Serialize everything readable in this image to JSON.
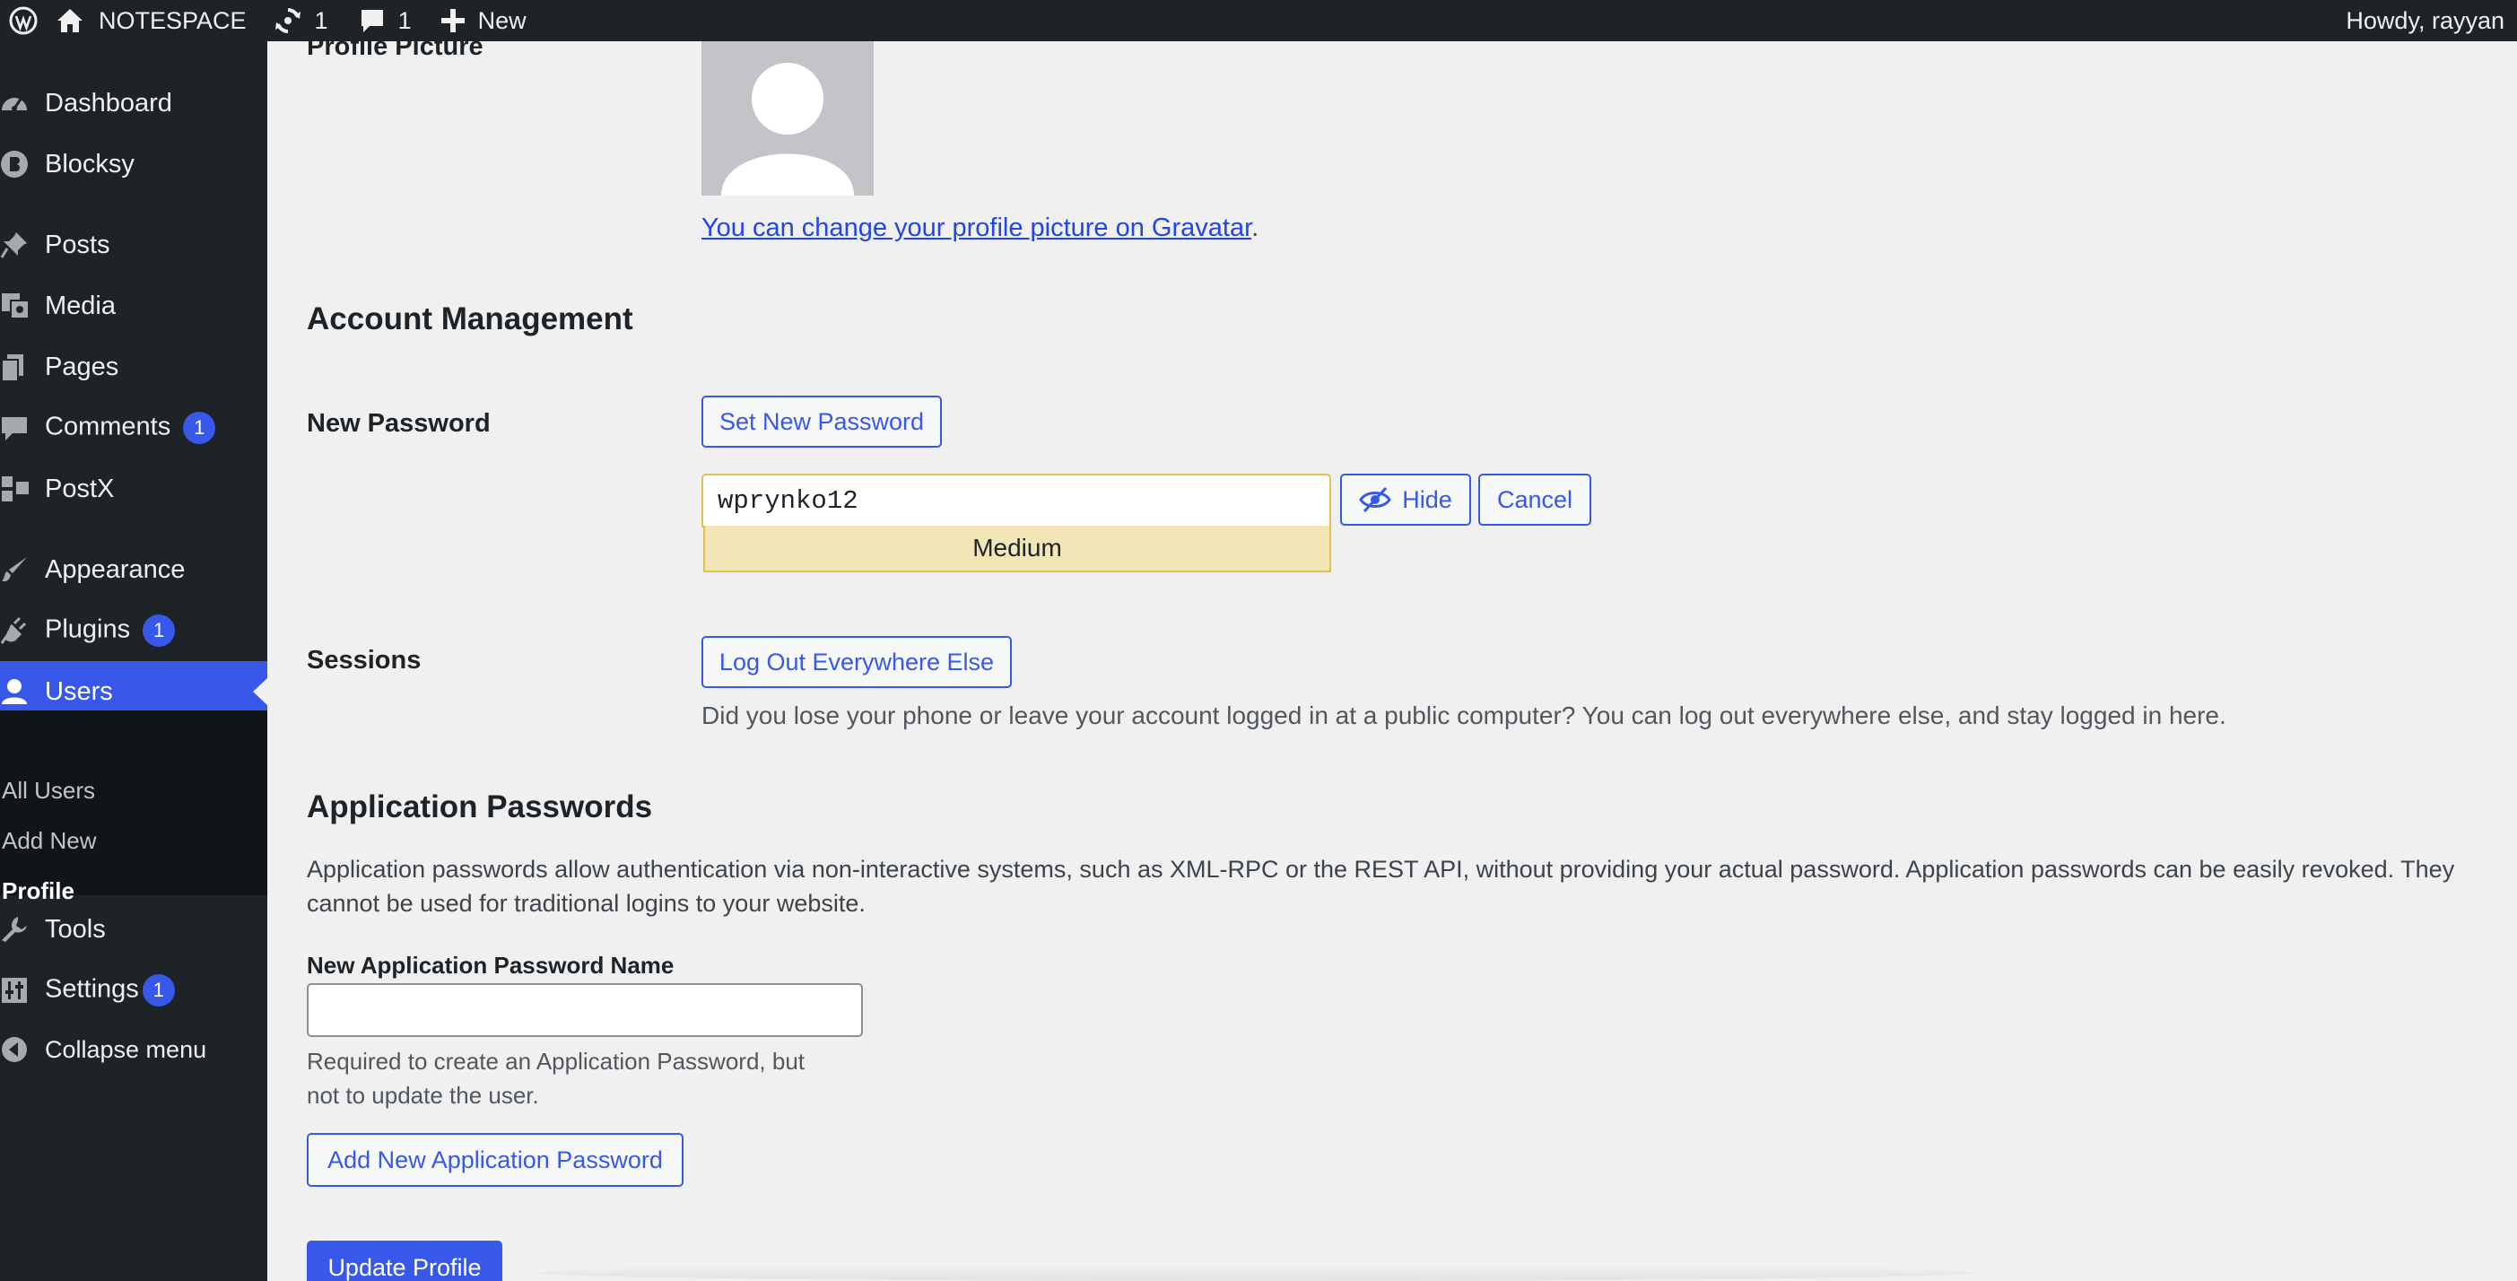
{
  "adminbar": {
    "site_name": "NOTESPACE",
    "updates_count": "1",
    "comments_count": "1",
    "new_label": "New",
    "howdy": "Howdy, rayyan"
  },
  "sidebar": {
    "items": [
      {
        "label": "Dashboard",
        "icon": "dashboard-icon"
      },
      {
        "label": "Blocksy",
        "icon": "blocksy-icon"
      },
      {
        "label": "Posts",
        "icon": "pin-icon"
      },
      {
        "label": "Media",
        "icon": "media-icon"
      },
      {
        "label": "Pages",
        "icon": "pages-icon"
      },
      {
        "label": "Comments",
        "icon": "comment-icon",
        "badge": "1"
      },
      {
        "label": "PostX",
        "icon": "postx-icon"
      },
      {
        "label": "Appearance",
        "icon": "brush-icon"
      },
      {
        "label": "Plugins",
        "icon": "plug-icon",
        "badge": "1"
      },
      {
        "label": "Users",
        "icon": "user-icon",
        "current": true
      },
      {
        "label": "Tools",
        "icon": "wrench-icon"
      },
      {
        "label": "Settings",
        "icon": "settings-icon",
        "badge": "1"
      },
      {
        "label": "Collapse menu",
        "icon": "collapse-icon"
      }
    ],
    "submenu": [
      "All Users",
      "Add New",
      "Profile"
    ],
    "active_submenu": "Profile"
  },
  "profile_picture": {
    "label": "Profile Picture",
    "link_text": "You can change your profile picture on Gravatar",
    "link_suffix": "."
  },
  "account_management": {
    "heading": "Account Management",
    "new_password_label": "New Password",
    "set_password_button": "Set New Password",
    "password_value": "wprynko12",
    "strength": "Medium",
    "hide_button": "Hide",
    "cancel_button": "Cancel",
    "sessions_label": "Sessions",
    "logout_button": "Log Out Everywhere Else",
    "sessions_desc": "Did you lose your phone or leave your account logged in at a public computer? You can log out everywhere else, and stay logged in here."
  },
  "application_passwords": {
    "heading": "Application Passwords",
    "description": "Application passwords allow authentication via non-interactive systems, such as XML-RPC or the REST API, without providing your actual password. Application passwords can be easily revoked. They cannot be used for traditional logins to your website.",
    "name_label": "New Application Password Name",
    "name_value": "",
    "help_line1": "Required to create an Application Password, but",
    "help_line2": "not to update the user.",
    "add_button": "Add New Application Password"
  },
  "update_button": "Update Profile",
  "colors": {
    "admin_bg": "#1d2327",
    "accent": "#3858e9",
    "page_bg": "#f0f0f1",
    "meter_medium": "#f2e5b6"
  }
}
